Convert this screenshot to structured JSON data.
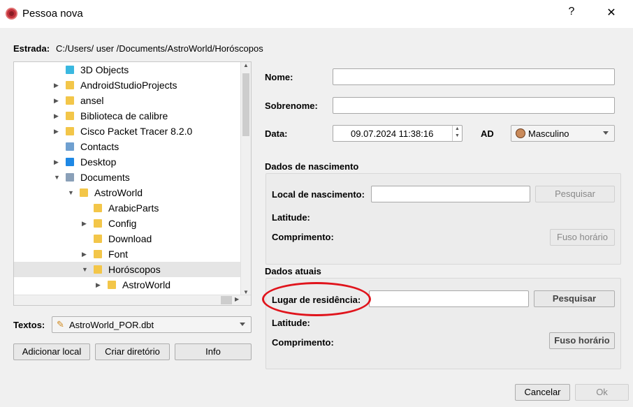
{
  "window": {
    "title": "Pessoa nova",
    "help": "?",
    "close": "✕"
  },
  "path": {
    "label": "Estrada:",
    "value": "C:/Users/ user /Documents/AstroWorld/Horóscopos"
  },
  "tree": [
    {
      "label": "3D Objects",
      "level": 1,
      "arrow": "",
      "icon": "3d-objects"
    },
    {
      "label": "AndroidStudioProjects",
      "level": 1,
      "arrow": "right",
      "icon": "folder"
    },
    {
      "label": "ansel",
      "level": 1,
      "arrow": "right",
      "icon": "folder"
    },
    {
      "label": "Biblioteca de calibre",
      "level": 1,
      "arrow": "right",
      "icon": "folder"
    },
    {
      "label": "Cisco Packet Tracer 8.2.0",
      "level": 1,
      "arrow": "right",
      "icon": "folder"
    },
    {
      "label": "Contacts",
      "level": 1,
      "arrow": "",
      "icon": "contacts"
    },
    {
      "label": "Desktop",
      "level": 1,
      "arrow": "right",
      "icon": "desktop"
    },
    {
      "label": "Documents",
      "level": 1,
      "arrow": "down",
      "icon": "documents"
    },
    {
      "label": "AstroWorld",
      "level": 2,
      "arrow": "down",
      "icon": "folder"
    },
    {
      "label": "ArabicParts",
      "level": 3,
      "arrow": "",
      "icon": "folder"
    },
    {
      "label": "Config",
      "level": 3,
      "arrow": "right",
      "icon": "folder"
    },
    {
      "label": "Download",
      "level": 3,
      "arrow": "",
      "icon": "folder"
    },
    {
      "label": "Font",
      "level": 3,
      "arrow": "right",
      "icon": "folder"
    },
    {
      "label": "Horóscopos",
      "level": 3,
      "arrow": "down",
      "icon": "folder",
      "selected": true
    },
    {
      "label": "AstroWorld",
      "level": 4,
      "arrow": "right",
      "icon": "folder"
    }
  ],
  "texts": {
    "label": "Textos:",
    "value": "AstroWorld_POR.dbt"
  },
  "buttons": {
    "add_place": "Adicionar local",
    "create_dir": "Criar diretório",
    "info": "Info",
    "cancel": "Cancelar",
    "ok": "Ok"
  },
  "form": {
    "name_label": "Nome:",
    "name_value": "",
    "surname_label": "Sobrenome:",
    "surname_value": "",
    "date_label": "Data:",
    "date_value": "09.07.2024 11:38:16",
    "era": "AD",
    "gender": "Masculino"
  },
  "birth": {
    "title": "Dados de nascimento",
    "place_label": "Local de nascimento:",
    "place_value": "",
    "search": "Pesquisar",
    "latitude_label": "Latitude:",
    "longitude_label": "Comprimento:",
    "timezone": "Fuso horário"
  },
  "current": {
    "title": "Dados atuais",
    "place_label": "Lugar de residência:",
    "place_value": "",
    "search": "Pesquisar",
    "latitude_label": "Latitude:",
    "longitude_label": "Comprimento:",
    "timezone": "Fuso horário"
  },
  "colors": {
    "highlight_ellipse": "#e0141c",
    "selected_row": "#e5e5e5"
  }
}
